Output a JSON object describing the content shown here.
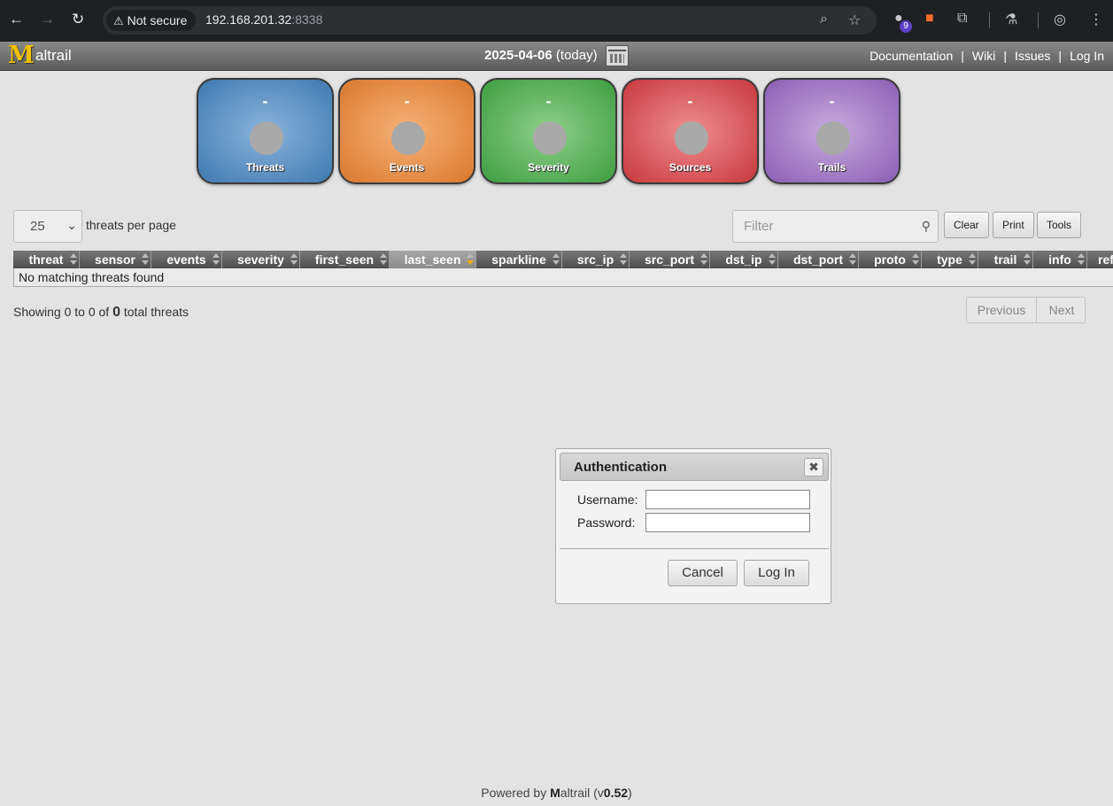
{
  "browser": {
    "security_label": "Not secure",
    "url_host": "192.168.201.32",
    "url_port": ":8338",
    "extension_badge": "9"
  },
  "app": {
    "logo_text": "altrail",
    "date_value": "2025-04-06",
    "date_suffix": "(today)",
    "links": [
      "Documentation",
      "Wiki",
      "Issues",
      "Log In"
    ]
  },
  "counters": [
    {
      "value": "-",
      "label": "Threats"
    },
    {
      "value": "-",
      "label": "Events"
    },
    {
      "value": "-",
      "label": "Severity"
    },
    {
      "value": "-",
      "label": "Sources"
    },
    {
      "value": "-",
      "label": "Trails"
    }
  ],
  "controls": {
    "per_page_value": "25",
    "per_page_label": "threats per page",
    "filter_placeholder": "Filter",
    "buttons": [
      "Clear",
      "Print",
      "Tools"
    ]
  },
  "table": {
    "columns": [
      "threat",
      "sensor",
      "events",
      "severity",
      "first_seen",
      "last_seen",
      "sparkline",
      "src_ip",
      "src_port",
      "dst_ip",
      "dst_port",
      "proto",
      "type",
      "trail",
      "info",
      "ref"
    ],
    "sorted_column": "last_seen",
    "empty_message": "No matching threats found"
  },
  "summary": {
    "prefix": "Showing 0 to 0 of",
    "total": "0",
    "suffix": "total threats"
  },
  "pager": {
    "previous": "Previous",
    "next": "Next"
  },
  "dialog": {
    "title": "Authentication",
    "username_label": "Username:",
    "password_label": "Password:",
    "cancel": "Cancel",
    "login": "Log In"
  },
  "footer": {
    "prefix": "Powered by",
    "brand_bold": "M",
    "brand_rest": "altrail (v",
    "version": "0.52",
    "close": ")"
  }
}
